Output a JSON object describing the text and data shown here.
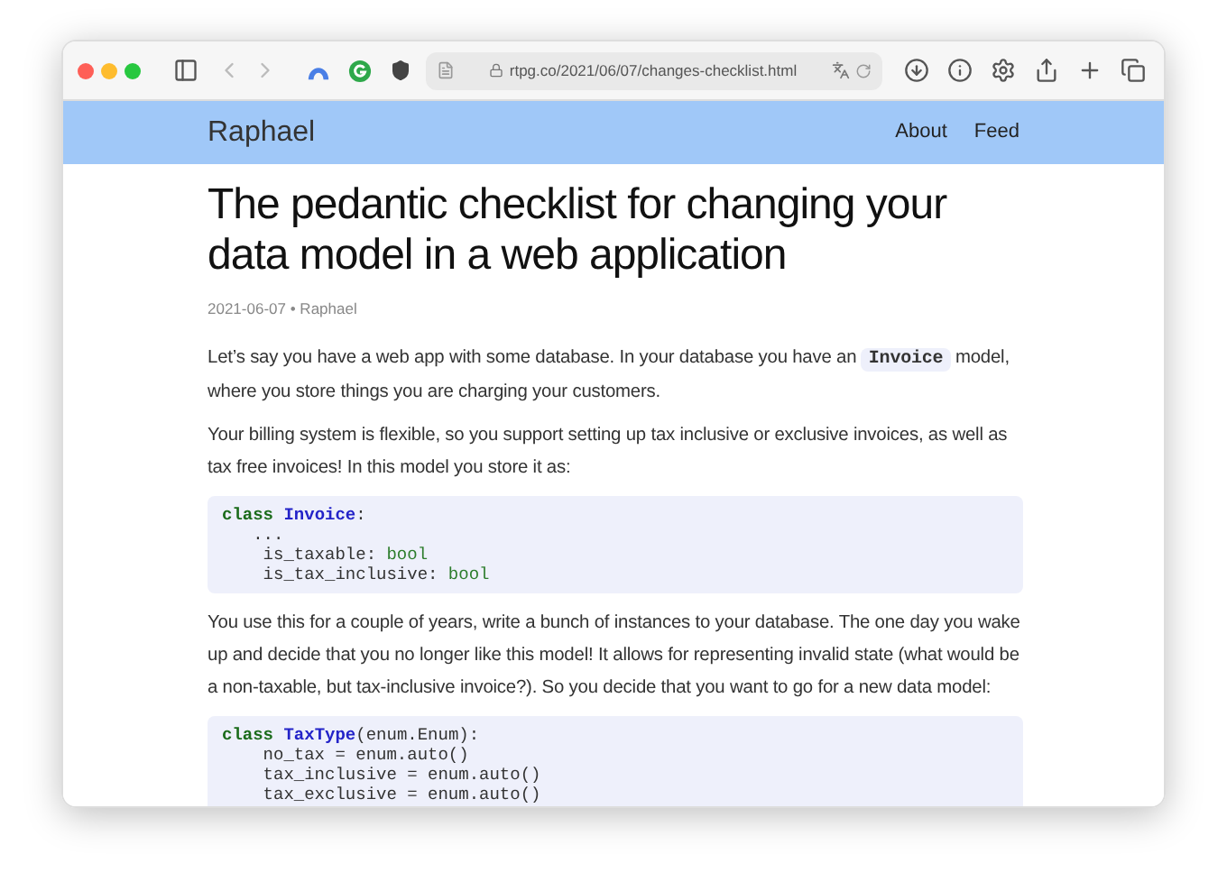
{
  "browser": {
    "url": "rtpg.co/2021/06/07/changes-checklist.html",
    "back_disabled": true,
    "forward_disabled": true
  },
  "site": {
    "name": "Raphael",
    "nav": [
      "About",
      "Feed"
    ]
  },
  "article": {
    "title": "The pedantic checklist for changing your data model in a web application",
    "meta": "2021-06-07 • Raphael",
    "blocks": [
      {
        "kind": "paragraph",
        "segments": [
          {
            "kind": "text",
            "text": "Let’s say you have a web app with some database. In your database you have an "
          },
          {
            "kind": "code",
            "text": "Invoice"
          },
          {
            "kind": "text",
            "text": " model, where you store things you are charging your customers."
          }
        ]
      },
      {
        "kind": "paragraph",
        "segments": [
          {
            "kind": "text",
            "text": "Your billing system is flexible, so you support setting up tax inclusive or exclusive invoices, as well as tax free invoices! In this model you store it as:"
          }
        ]
      },
      {
        "kind": "code",
        "lines": [
          [
            {
              "kind": "keyword",
              "text": "class "
            },
            {
              "kind": "name",
              "text": "Invoice"
            },
            {
              "kind": "plain",
              "text": ":"
            }
          ],
          [
            {
              "kind": "plain",
              "text": "   ..."
            }
          ],
          [
            {
              "kind": "plain",
              "text": "    is_taxable: "
            },
            {
              "kind": "type",
              "text": "bool"
            }
          ],
          [
            {
              "kind": "plain",
              "text": "    is_tax_inclusive: "
            },
            {
              "kind": "type",
              "text": "bool"
            }
          ]
        ]
      },
      {
        "kind": "paragraph",
        "segments": [
          {
            "kind": "text",
            "text": "You use this for a couple of years, write a bunch of instances to your database. The one day you wake up and decide that you no longer like this model! It allows for representing invalid state (what would be a non-taxable, but tax-inclusive invoice?). So you decide that you want to go for a new data model:"
          }
        ]
      },
      {
        "kind": "code",
        "lines": [
          [
            {
              "kind": "keyword",
              "text": "class "
            },
            {
              "kind": "name",
              "text": "TaxType"
            },
            {
              "kind": "plain",
              "text": "(enum.Enum):"
            }
          ],
          [
            {
              "kind": "plain",
              "text": "    no_tax = enum.auto()"
            }
          ],
          [
            {
              "kind": "plain",
              "text": "    tax_inclusive = enum.auto()"
            }
          ],
          [
            {
              "kind": "plain",
              "text": "    tax_exclusive = enum.auto()"
            }
          ]
        ]
      }
    ]
  }
}
